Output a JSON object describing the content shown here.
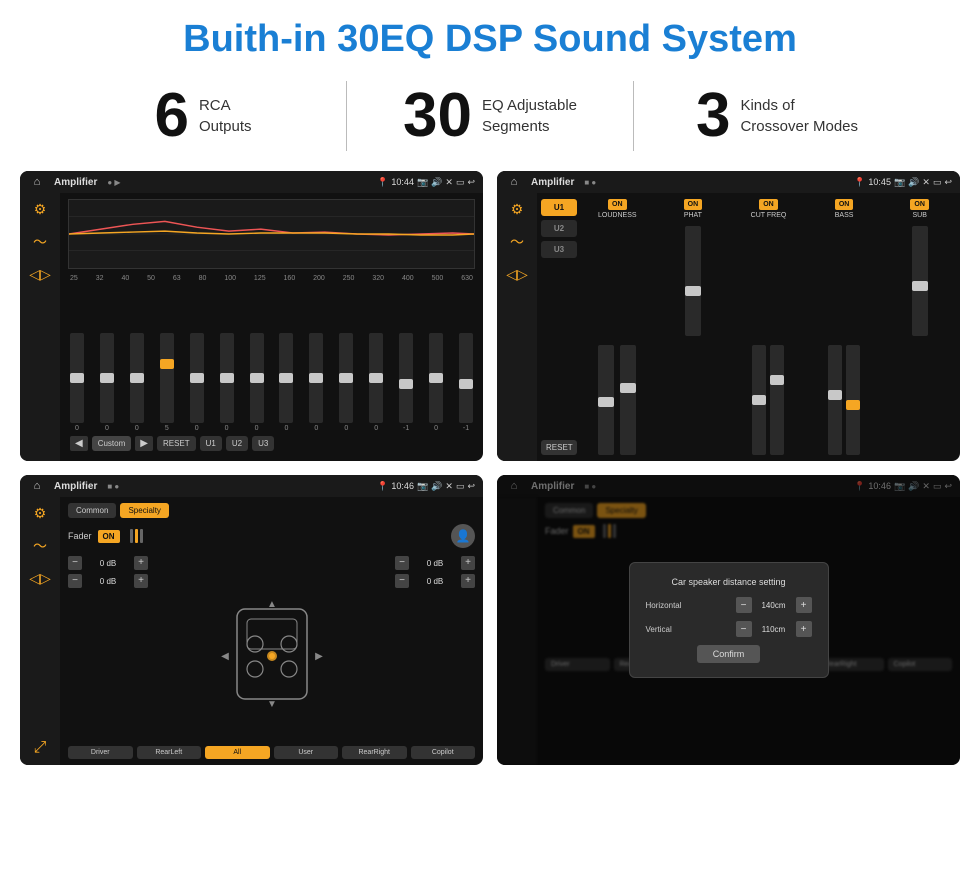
{
  "page": {
    "title": "Buith-in 30EQ DSP Sound System",
    "stats": [
      {
        "number": "6",
        "text": "RCA\nOutputs"
      },
      {
        "number": "30",
        "text": "EQ Adjustable\nSegments"
      },
      {
        "number": "3",
        "text": "Kinds of\nCrossover Modes"
      }
    ],
    "screens": [
      {
        "id": "eq-screen",
        "label": "EQ Screen",
        "app_name": "Amplifier",
        "time": "10:44",
        "eq_freqs": [
          "25",
          "32",
          "40",
          "50",
          "63",
          "80",
          "100",
          "125",
          "160",
          "200",
          "250",
          "320",
          "400",
          "500",
          "630"
        ],
        "eq_values": [
          "0",
          "0",
          "0",
          "5",
          "0",
          "0",
          "0",
          "0",
          "0",
          "0",
          "0",
          "-1",
          "0",
          "-1"
        ],
        "presets": [
          "Custom",
          "RESET",
          "U1",
          "U2",
          "U3"
        ]
      },
      {
        "id": "mixer-screen",
        "label": "Mixer Screen",
        "app_name": "Amplifier",
        "time": "10:45",
        "presets": [
          "U1",
          "U2",
          "U3"
        ],
        "channels": [
          "LOUDNESS",
          "PHAT",
          "CUT FREQ",
          "BASS",
          "SUB"
        ],
        "reset_label": "RESET"
      },
      {
        "id": "fader-screen",
        "label": "Fader Screen",
        "app_name": "Amplifier",
        "time": "10:46",
        "tabs": [
          "Common",
          "Specialty"
        ],
        "fader_label": "Fader",
        "on_label": "ON",
        "controls": [
          "Driver",
          "RearLeft",
          "All",
          "User",
          "RearRight",
          "Copilot"
        ],
        "db_values": [
          "0 dB",
          "0 dB",
          "0 dB",
          "0 dB"
        ]
      },
      {
        "id": "dialog-screen",
        "label": "Dialog Screen",
        "app_name": "Amplifier",
        "time": "10:46",
        "dialog": {
          "title": "Car speaker distance setting",
          "horizontal_label": "Horizontal",
          "horizontal_value": "140cm",
          "vertical_label": "Vertical",
          "vertical_value": "110cm",
          "confirm_label": "Confirm"
        }
      }
    ]
  }
}
